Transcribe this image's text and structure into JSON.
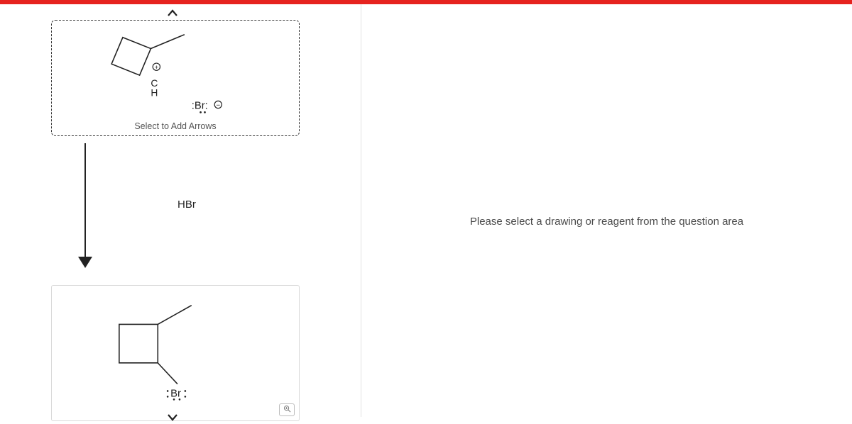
{
  "right_panel": {
    "message": "Please select a drawing or reagent from the question area"
  },
  "reaction": {
    "reagent_label": "HBr"
  },
  "card_top": {
    "help_text": "Select to Add Arrows",
    "atom_c": "C",
    "atom_h": "H",
    "br_label": ":Br:",
    "charge_plus": "+",
    "charge_minus": "−"
  },
  "card_bottom": {
    "br_label": "Br"
  },
  "icons": {
    "chevron_up": "chevron-up-icon",
    "chevron_down": "chevron-down-icon",
    "zoom": "magnifier-icon"
  }
}
